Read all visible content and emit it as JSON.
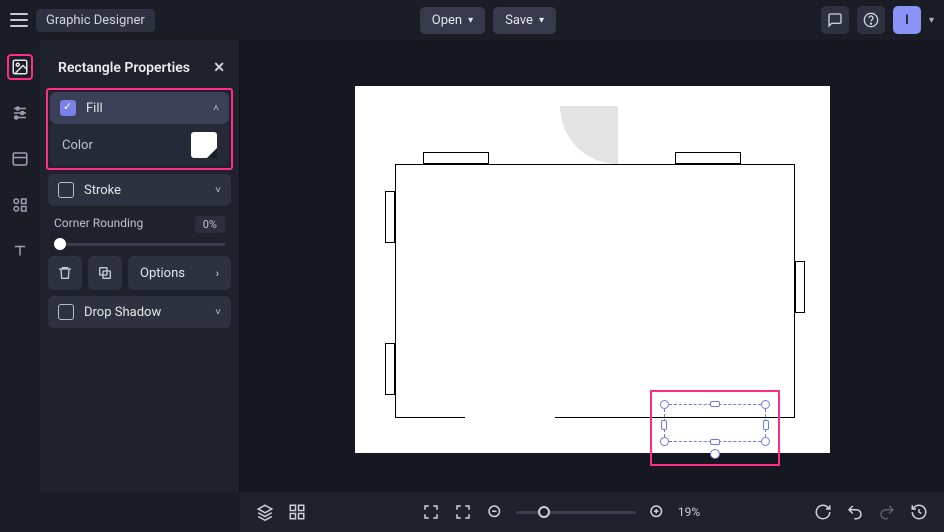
{
  "header": {
    "app_title": "Graphic Designer",
    "open_label": "Open",
    "save_label": "Save",
    "avatar_initial": "I"
  },
  "panel": {
    "title": "Rectangle Properties",
    "fill_label": "Fill",
    "fill_checked": true,
    "color_label": "Color",
    "fill_color": "#FFFFFF",
    "stroke_label": "Stroke",
    "stroke_checked": false,
    "corner_label": "Corner Rounding",
    "corner_value": "0%",
    "options_label": "Options",
    "dropshadow_label": "Drop Shadow",
    "dropshadow_checked": false
  },
  "leftrail": {
    "items": [
      "image-tool",
      "sliders-tool",
      "layout-tool",
      "shapes-tool",
      "text-tool"
    ]
  },
  "canvas": {
    "zoom_pct": "19%"
  }
}
